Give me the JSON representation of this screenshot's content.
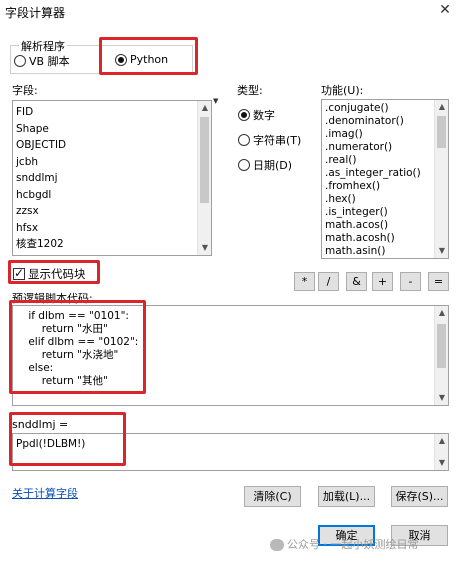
{
  "window": {
    "title": "字段计算器"
  },
  "parser": {
    "group_label": "解析程序",
    "options": [
      {
        "label": "VB 脚本",
        "selected": false
      },
      {
        "label": "Python",
        "selected": true
      }
    ]
  },
  "fields": {
    "label": "字段:",
    "items": [
      "FID",
      "Shape",
      "OBJECTID",
      "jcbh",
      "snddlmj",
      "hcbgdl",
      "zzsx",
      "hfsx",
      "核查1202"
    ]
  },
  "type": {
    "label": "类型:",
    "options": [
      {
        "label": "数字",
        "selected": true
      },
      {
        "label": "字符串(T)",
        "selected": false
      },
      {
        "label": "日期(D)",
        "selected": false
      }
    ]
  },
  "functions": {
    "label": "功能(U):",
    "items": [
      ".conjugate()",
      ".denominator()",
      ".imag()",
      ".numerator()",
      ".real()",
      ".as_integer_ratio()",
      ".fromhex()",
      ".hex()",
      ".is_integer()",
      "math.acos()",
      "math.acosh()",
      "math.asin()"
    ]
  },
  "show_codeblock": {
    "label": "显示代码块",
    "checked": true
  },
  "operators": [
    "*",
    "/",
    "&",
    "+",
    "-",
    "="
  ],
  "codeblock": {
    "label": "预逻辑脚本代码:",
    "lines": [
      "    if dlbm == \"0101\":",
      "        return \"水田\"",
      "    elif dlbm == \"0102\":",
      "        return \"水浇地\"",
      "    else:",
      "        return \"其他\""
    ]
  },
  "expression": {
    "label": "snddlmj =",
    "value": "Ppdl(!DLBM!)"
  },
  "about_link": "关于计算字段",
  "buttons": {
    "clear": "清除(C)",
    "load": "加载(L)...",
    "save": "保存(S)...",
    "ok": "确定",
    "cancel": "取消"
  },
  "watermark": "公众号 · 一起小妖测绘日常",
  "colors": {
    "highlight_box": "#d9252b",
    "link": "#0b4fb3",
    "default_button_border": "#0078d7"
  }
}
